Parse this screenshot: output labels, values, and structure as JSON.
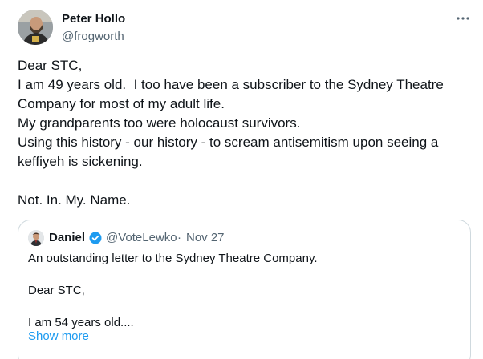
{
  "author": {
    "name": "Peter Hollo",
    "handle": "@frogworth"
  },
  "tweet": {
    "lines": [
      "Dear STC,",
      "I am 49 years old.  I too have been a subscriber to the Sydney Theatre",
      "Company for most of my adult life.",
      "My grandparents too were holocaust survivors.",
      "Using this history - our history - to scream antisemitism upon seeing a",
      "keffiyeh is sickening.",
      "",
      "Not. In. My. Name."
    ]
  },
  "quote": {
    "name": "Daniel",
    "handle": "@VoteLewko",
    "separator": "·",
    "date": "Nov 27",
    "lines": [
      "An outstanding letter to the Sydney Theatre Company.",
      "",
      "Dear STC,",
      "",
      "I am 54 years old...."
    ],
    "show_more": "Show more"
  },
  "icons": {
    "more": "more-horizontal-icon",
    "verified": "verified-badge-icon"
  },
  "colors": {
    "text": "#0f1419",
    "secondary": "#536471",
    "link": "#1d9bf0",
    "border": "#cfd9de"
  }
}
